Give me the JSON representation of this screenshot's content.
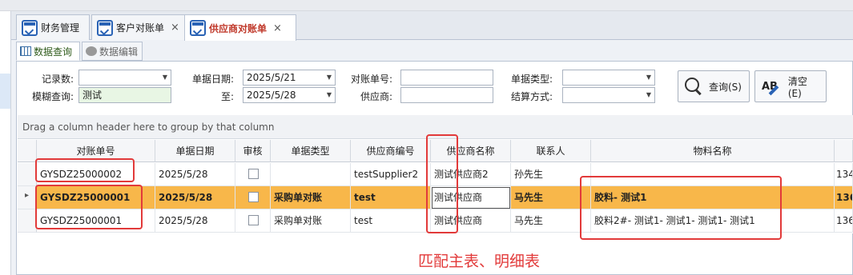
{
  "doc_tabs": [
    {
      "label": "财务管理",
      "active": false
    },
    {
      "label": "客户对账单",
      "active": false,
      "closable": true
    },
    {
      "label": "供应商对账单",
      "active": true,
      "closable": true
    }
  ],
  "close_glyph": "×",
  "sub_tabs": [
    {
      "label": "数据查询",
      "active": true
    },
    {
      "label": "数据编辑",
      "active": false
    }
  ],
  "filters": {
    "record_count_label": "记录数:",
    "record_count_value": "",
    "fuzzy_label": "模糊查询:",
    "fuzzy_value": "测试",
    "date_label": "单据日期:",
    "date_from": "2025/5/21",
    "to_label": "至:",
    "date_to": "2025/5/28",
    "statement_no_label": "对账单号:",
    "statement_no_value": "",
    "supplier_label": "供应商:",
    "supplier_value": "",
    "doc_type_label": "单据类型:",
    "doc_type_value": "",
    "settle_label": "结算方式:",
    "settle_value": ""
  },
  "buttons": {
    "query": "查询(S)",
    "clear": "清空(E)",
    "ab_glyph": "AB"
  },
  "grid": {
    "group_hint": "Drag a column header here to group by that column",
    "columns": [
      "对账单号",
      "单据日期",
      "审核",
      "单据类型",
      "供应商编号",
      "供应商名称",
      "联系人",
      "物料名称",
      ""
    ],
    "rows": [
      {
        "no": "GYSDZ25000002",
        "date": "2025/5/28",
        "type": "",
        "supplier_code": "testSupplier2",
        "supplier_name": "测试供应商2",
        "contact": "孙先生",
        "material": "",
        "extra": "134"
      },
      {
        "no": "GYSDZ25000001",
        "date": "2025/5/28",
        "type": "采购单对账",
        "supplier_code": "test",
        "supplier_name": "测试供应商",
        "contact": "马先生",
        "material": "胶料- 测试1",
        "extra": "136",
        "selected": true
      },
      {
        "no": "GYSDZ25000001",
        "date": "2025/5/28",
        "type": "采购单对账",
        "supplier_code": "test",
        "supplier_name": "测试供应商",
        "contact": "马先生",
        "material": "胶料2#- 测试1- 测试1- 测试1- 测试1",
        "extra": "136"
      }
    ]
  },
  "annotation": "匹配主表、明细表",
  "colors": {
    "selected_row": "#f8b74a",
    "annotation": "#e23a3a",
    "active_tab_text": "#c0392b"
  }
}
